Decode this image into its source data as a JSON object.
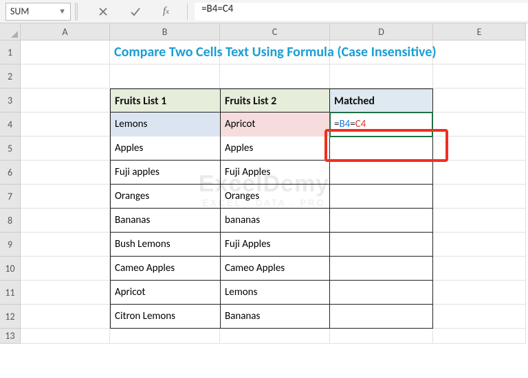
{
  "nameBox": "SUM",
  "formulaBar": "=B4=C4",
  "title": "Compare Two Cells Text Using Formula (Case Insensitive)",
  "columns": [
    "A",
    "B",
    "C",
    "D",
    "E"
  ],
  "rows": [
    "1",
    "2",
    "3",
    "4",
    "5",
    "6",
    "7",
    "8",
    "9",
    "10",
    "11",
    "12",
    "13"
  ],
  "headers": {
    "b": "Fruits List 1",
    "c": "Fruits List 2",
    "d": "Matched"
  },
  "data": [
    {
      "b": "Lemons",
      "c": "Apricot"
    },
    {
      "b": "Apples",
      "c": "Apples"
    },
    {
      "b": "Fuji apples",
      "c": "Fuji Apples"
    },
    {
      "b": "Oranges",
      "c": "Oranges"
    },
    {
      "b": "Bananas",
      "c": "bananas"
    },
    {
      "b": "Bush Lemons",
      "c": "Fuji Apples"
    },
    {
      "b": "Cameo Apples",
      "c": "Cameo Apples"
    },
    {
      "b": "Apricot",
      "c": "Lemons"
    },
    {
      "b": "Citron Lemons",
      "c": "Bananas"
    }
  ],
  "formulaParts": {
    "eq1": "=",
    "ref1": "B4",
    "eq2": "=",
    "ref2": "C4"
  },
  "watermark": {
    "line1": "ExcelDemy",
    "line2": "EXCEL · DATA · PRO"
  }
}
